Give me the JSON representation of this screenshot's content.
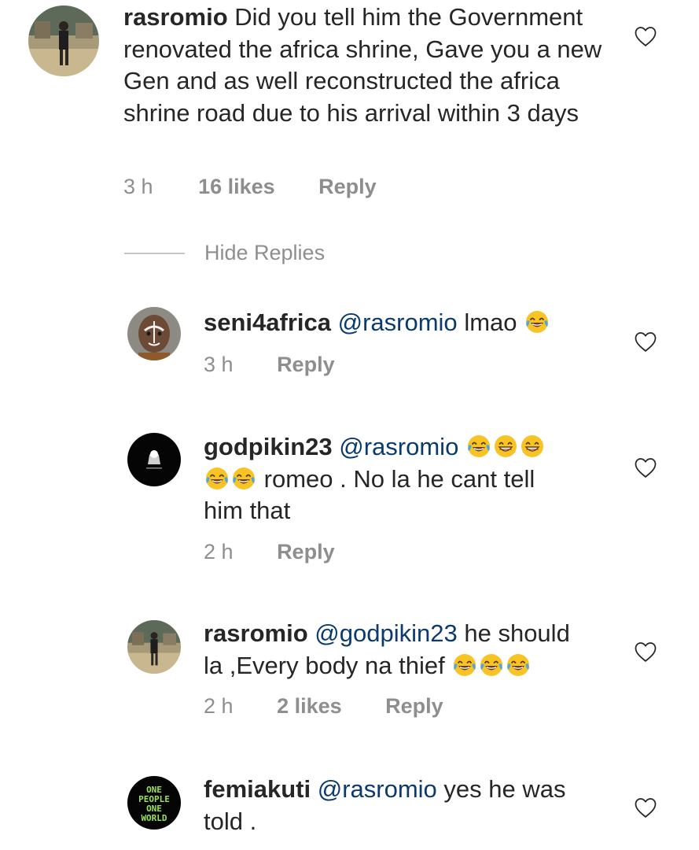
{
  "comments": [
    {
      "username": "rasromio",
      "mention": "",
      "body": "Did you tell him the Government renovated the africa shrine, Gave you a new Gen and as well reconstructed the africa shrine road due to  his arrival within 3 days",
      "time": "3 h",
      "likes": "16 likes",
      "reply": "Reply",
      "avatar": "person-standing-avatar"
    },
    {
      "username": "seni4africa",
      "mention": "@rasromio",
      "body": "lmao",
      "emojis_after": [
        "face-with-tears-of-joy"
      ],
      "time": "3 h",
      "likes": "",
      "reply": "Reply",
      "avatar": "child-face-avatar"
    },
    {
      "username": "godpikin23",
      "mention": "@rasromio",
      "emojis_mid": [
        "face-with-tears-of-joy",
        "beaming-face",
        "beaming-face",
        "face-with-tears-of-joy",
        "face-with-tears-of-joy"
      ],
      "body_tail": "romeo . No la he cant tell",
      "body_line3": "him that",
      "time": "2 h",
      "likes": "",
      "reply": "Reply",
      "avatar": "black-circle-logo-avatar"
    },
    {
      "username": "rasromio",
      "mention": "@godpikin23",
      "body_line1": "he should",
      "body_line2": "la ,Every body na thief",
      "emojis_after": [
        "face-with-tears-of-joy",
        "face-with-tears-of-joy",
        "face-with-tears-of-joy"
      ],
      "time": "2 h",
      "likes": "2 likes",
      "reply": "Reply",
      "avatar": "person-standing-avatar"
    },
    {
      "username": "femiakuti",
      "mention": "@rasromio",
      "body_line1": "yes he was",
      "body_line2": "told .",
      "time": "",
      "likes": "",
      "reply": "",
      "avatar": "one-people-one-world-avatar",
      "avatar_text": [
        "ONE",
        "PEOPLE",
        "ONE",
        "WORLD"
      ]
    }
  ],
  "hide_replies_label": "Hide Replies",
  "colors": {
    "text": "#262626",
    "meta": "#8e8e8e",
    "mention": "#0b3b6e",
    "logo_green": "#9be15d"
  }
}
